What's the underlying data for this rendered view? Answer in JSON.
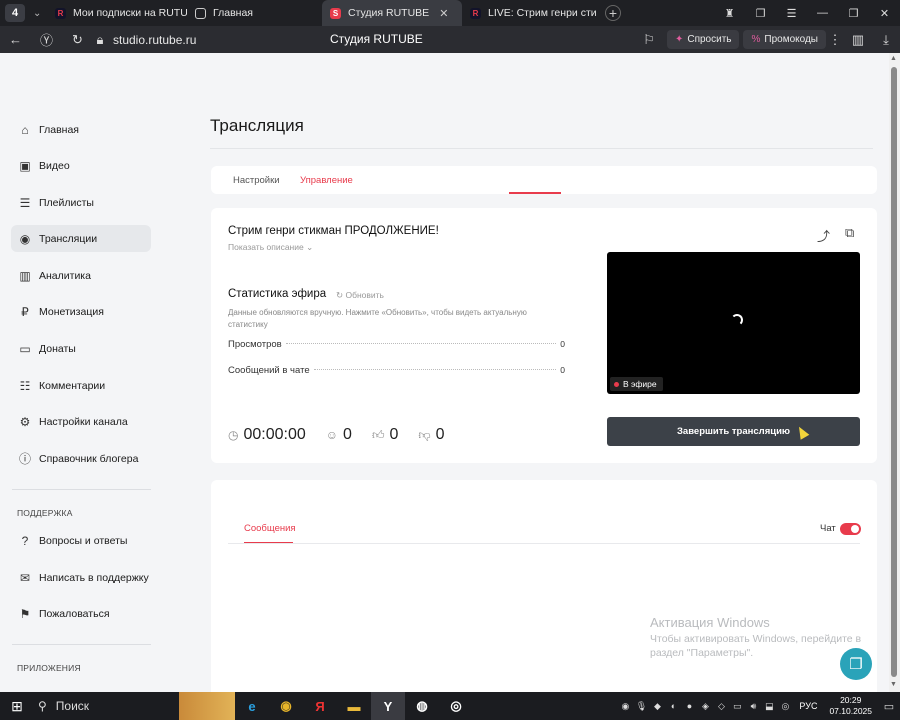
{
  "browser": {
    "tabs": [
      {
        "title": "Мои подписки на RUTUBE",
        "active": false
      },
      {
        "title": "Главная",
        "active": false
      },
      {
        "title": "Студия RUTUBE",
        "active": true
      },
      {
        "title": "LIVE: Стрим генри стикм",
        "active": false
      }
    ],
    "url": "studio.rutube.ru",
    "page_title": "Студия RUTUBE",
    "ask_label": "Спросить",
    "promo_label": "Промокоды"
  },
  "sidebar": {
    "items": [
      {
        "label": "Главная",
        "icon": "home-icon"
      },
      {
        "label": "Видео",
        "icon": "video-icon"
      },
      {
        "label": "Плейлисты",
        "icon": "playlist-icon"
      },
      {
        "label": "Трансляции",
        "icon": "broadcast-icon",
        "active": true
      },
      {
        "label": "Аналитика",
        "icon": "analytics-icon"
      },
      {
        "label": "Монетизация",
        "icon": "ruble-icon"
      },
      {
        "label": "Донаты",
        "icon": "donate-icon"
      },
      {
        "label": "Комментарии",
        "icon": "comment-icon"
      },
      {
        "label": "Настройки канала",
        "icon": "gear-icon"
      },
      {
        "label": "Справочник блогера",
        "icon": "info-icon"
      }
    ],
    "support_title": "ПОДДЕРЖКА",
    "support_items": [
      {
        "label": "Вопросы и ответы",
        "icon": "help-icon"
      },
      {
        "label": "Написать в поддержку",
        "icon": "mail-icon"
      },
      {
        "label": "Пожаловаться",
        "icon": "flag-icon"
      }
    ],
    "apps_title": "ПРИЛОЖЕНИЯ"
  },
  "main": {
    "title": "Трансляция",
    "tabs": [
      {
        "label": "Настройки",
        "active": false
      },
      {
        "label": "Управление",
        "active": true
      }
    ],
    "stream": {
      "title": "Стрим генри стикман ПРОДОЛЖЕНИЕ!",
      "show_description": "Показать описание",
      "stats_title": "Статистика эфира",
      "refresh_label": "Обновить",
      "stats_note": "Данные обновляются вручную. Нажмите «Обновить», чтобы видеть актуальную статистику",
      "stats": [
        {
          "label": "Просмотров",
          "value": "0"
        },
        {
          "label": "Сообщений в чате",
          "value": "0"
        }
      ],
      "duration": "00:00:00",
      "viewers": "0",
      "likes": "0",
      "dislikes": "0",
      "live_badge": "В эфире",
      "end_button": "Завершить трансляцию"
    },
    "chat": {
      "messages_tab": "Сообщения",
      "chat_label": "Чат",
      "chat_enabled": true
    }
  },
  "watermark": {
    "title": "Активация Windows",
    "subtitle": "Чтобы активировать Windows, перейдите в раздел \"Параметры\"."
  },
  "taskbar": {
    "search": "Поиск",
    "lang": "РУС",
    "time": "20:29",
    "date": "07.10.2025"
  },
  "colors": {
    "accent": "#e83b4c",
    "button_dark": "#3c4148",
    "fab": "#2aa3b9"
  }
}
